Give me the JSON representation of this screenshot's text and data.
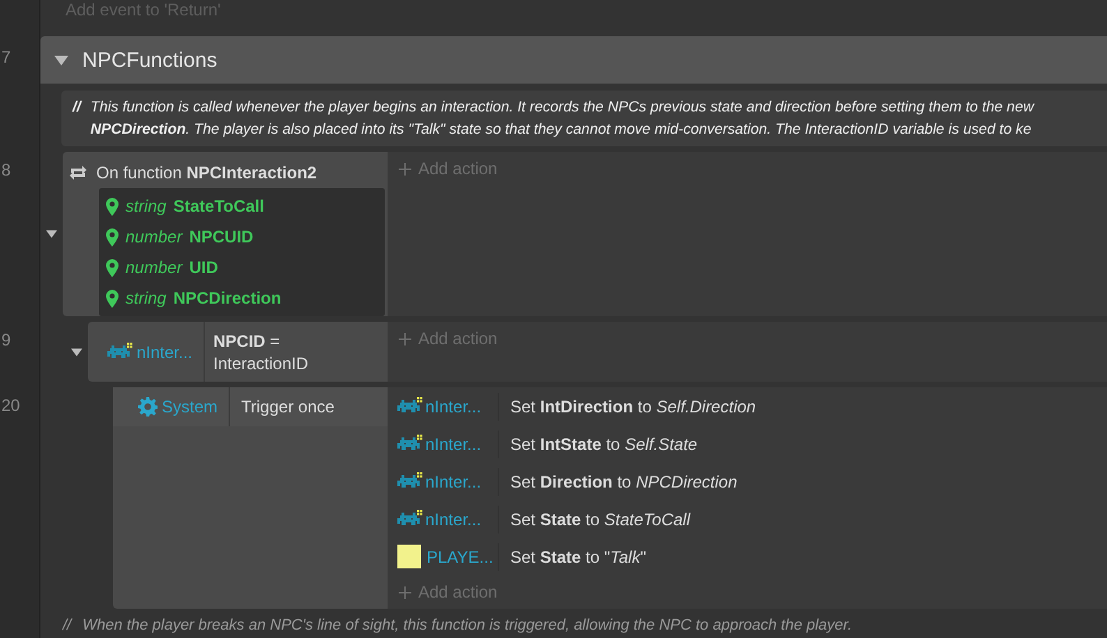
{
  "add_event_hint": "Add event to 'Return'",
  "group": {
    "line_number": "7",
    "name": "NPCFunctions",
    "expanded": true
  },
  "comments": [
    {
      "marker": "//",
      "lines": [
        "This function is called whenever the player begins an interaction. It records the NPCs previous state and direction before setting them to the new",
        "**NPCDirection**. The player is also placed into its \"Talk\" state so that they cannot move mid-conversation. The InteractionID variable is used to ke"
      ]
    }
  ],
  "events": [
    {
      "line_number": "8",
      "expanded": true,
      "conditions": [
        {
          "kind": "function",
          "text": "On function **NPCInteraction2**",
          "params": [
            {
              "type": "string",
              "name": "StateToCall"
            },
            {
              "type": "number",
              "name": "NPCUID"
            },
            {
              "type": "number",
              "name": "UID"
            },
            {
              "type": "string",
              "name": "NPCDirection"
            }
          ]
        }
      ],
      "add_action": "Add action",
      "children": [
        {
          "line_number": "9",
          "expanded": true,
          "conditions": [
            {
              "kind": "object",
              "object": "nInter...",
              "text": "**NPCID** = InteractionID"
            }
          ],
          "add_action": "Add action",
          "children": [
            {
              "line_number": "20",
              "conditions": [
                {
                  "kind": "system",
                  "object": "System",
                  "text": "Trigger once"
                }
              ],
              "actions": [
                {
                  "kind": "sprite",
                  "object": "nInter...",
                  "text": "Set **IntDirection** to *Self.Direction*"
                },
                {
                  "kind": "sprite",
                  "object": "nInter...",
                  "text": "Set **IntState** to *Self.State*"
                },
                {
                  "kind": "sprite",
                  "object": "nInter...",
                  "text": "Set **Direction** to *NPCDirection*"
                },
                {
                  "kind": "sprite",
                  "object": "nInter...",
                  "text": "Set **State** to *StateToCall*"
                },
                {
                  "kind": "swatch",
                  "color": "#f2f28c",
                  "object": "PLAYE...",
                  "text": "Set **State** to \"*Talk*\""
                }
              ],
              "add_action": "Add action"
            }
          ]
        }
      ]
    }
  ],
  "footer_comment": {
    "marker": "//",
    "text": "When the player breaks an NPC's line of sight, this function is triggered, allowing the NPC to approach the player."
  }
}
